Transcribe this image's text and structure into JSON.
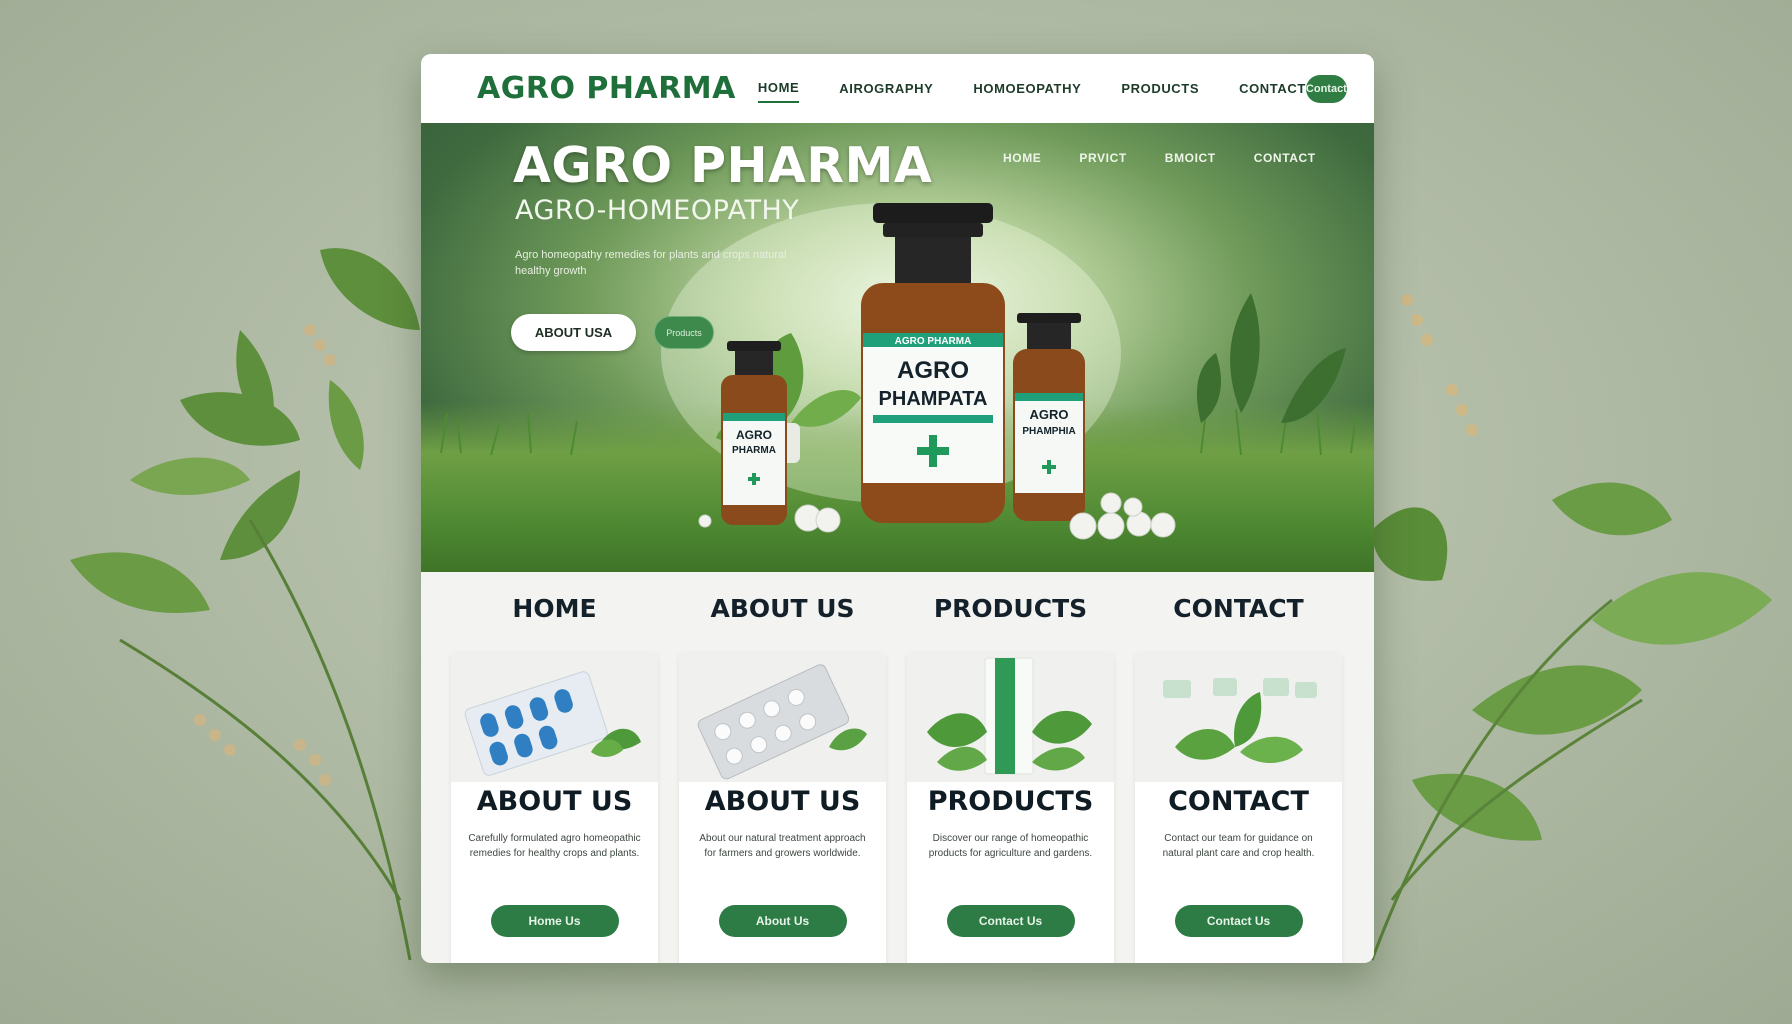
{
  "colors": {
    "brand_green": "#1f6f3a",
    "button_green": "#2e7c45",
    "page_bg": "#b4bfa9"
  },
  "navbar": {
    "logo_icon": "leaf-icon",
    "brand": "AGRO PHARMA",
    "links": [
      "HOME",
      "AIROGRAPHY",
      "HOMOEOPATHY",
      "PRODUCTS",
      "CONTACT"
    ],
    "cta_label": "Contact"
  },
  "hero": {
    "title": "AGRO PHARMA",
    "subtitle": "AGRO-HOMEOPATHY",
    "description": "Agro homeopathy remedies for plants and crops natural healthy growth",
    "about_button": "ABOUT USA",
    "more_button": "Products",
    "nav": [
      "HOME",
      "PRVICT",
      "BMOICT",
      "CONTACT"
    ],
    "bottles": {
      "big": {
        "brand": "AGRO PHARMA",
        "name_line1": "AGRO",
        "name_line2": "PHAMPATA"
      },
      "left": {
        "name_line1": "AGRO",
        "name_line2": "PHARMA"
      },
      "right": {
        "name_line1": "AGRO",
        "name_line2": "PHAMPHIA"
      }
    }
  },
  "sections": [
    {
      "heading": "HOME",
      "card_title": "ABOUT US",
      "image": "blister-pack-blue-pills",
      "text": "Carefully formulated agro homeopathic remedies for healthy crops and plants.",
      "button": "Home Us"
    },
    {
      "heading": "ABOUT US",
      "card_title": "ABOUT US",
      "image": "blister-pack-white-pills",
      "text": "About our natural treatment approach for farmers and growers worldwide.",
      "button": "About Us"
    },
    {
      "heading": "PRODUCTS",
      "card_title": "PRODUCTS",
      "image": "product-box-with-leaves",
      "text": "Discover our range of homeopathic products for agriculture and gardens.",
      "button": "Contact Us"
    },
    {
      "heading": "CONTACT",
      "card_title": "CONTACT",
      "image": "herbal-leaves",
      "text": "Contact our team for guidance on natural plant care and crop health.",
      "button": "Contact Us"
    }
  ]
}
